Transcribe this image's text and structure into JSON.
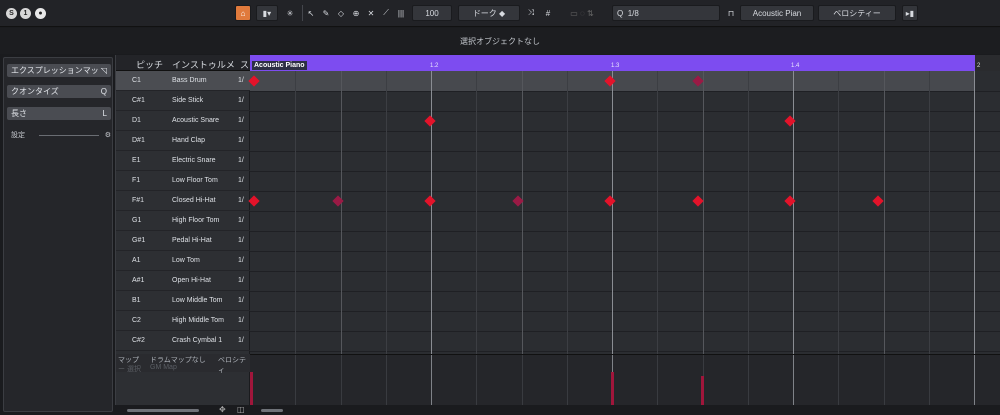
{
  "toolbar": {
    "zoom_value": "100",
    "drum_mode": "ドーク",
    "quantize": "1/8",
    "instrument": "Acoustic Pian",
    "lane": "ベロシティー"
  },
  "status": {
    "text": "選択オブジェクトなし"
  },
  "inspector": {
    "expression_map": "エクスプレッションマッ",
    "quantize": "クオンタイズ",
    "quantize_key": "Q",
    "length": "長さ",
    "length_key": "L",
    "settings": "設定"
  },
  "droplist": {
    "headers": {
      "pitch": "ピッチ",
      "instrument": "インストゥルメ",
      "extra": "ス"
    },
    "rows": [
      {
        "pitch": "C1",
        "name": "Bass Drum",
        "q": "1/"
      },
      {
        "pitch": "C#1",
        "name": "Side Stick",
        "q": "1/"
      },
      {
        "pitch": "D1",
        "name": "Acoustic Snare",
        "q": "1/"
      },
      {
        "pitch": "D#1",
        "name": "Hand Clap",
        "q": "1/"
      },
      {
        "pitch": "E1",
        "name": "Electric Snare",
        "q": "1/"
      },
      {
        "pitch": "F1",
        "name": "Low Floor Tom",
        "q": "1/"
      },
      {
        "pitch": "F#1",
        "name": "Closed Hi-Hat",
        "q": "1/"
      },
      {
        "pitch": "G1",
        "name": "High Floor Tom",
        "q": "1/"
      },
      {
        "pitch": "G#1",
        "name": "Pedal Hi-Hat",
        "q": "1/"
      },
      {
        "pitch": "A1",
        "name": "Low Tom",
        "q": "1/"
      },
      {
        "pitch": "A#1",
        "name": "Open Hi-Hat",
        "q": "1/"
      },
      {
        "pitch": "B1",
        "name": "Low Middle Tom",
        "q": "1/"
      },
      {
        "pitch": "C2",
        "name": "High Middle Tom",
        "q": "1/"
      },
      {
        "pitch": "C#2",
        "name": "Crash Cymbal 1",
        "q": "1/"
      }
    ],
    "footer": {
      "map": "マップ",
      "drum_map": "ドラムマップなし",
      "velocity": "ベロシティ",
      "map_sub": "ー 選択",
      "gm_map": "GM Map"
    }
  },
  "ruler": {
    "part_name": "Acoustic Piano",
    "marks": [
      "1.2",
      "1.3",
      "1.4",
      "2"
    ]
  },
  "colors": {
    "ruler": "#7d4cf0",
    "note": "#e3132a",
    "note_dim": "#9a1a45",
    "accent": "#e07a3c"
  }
}
